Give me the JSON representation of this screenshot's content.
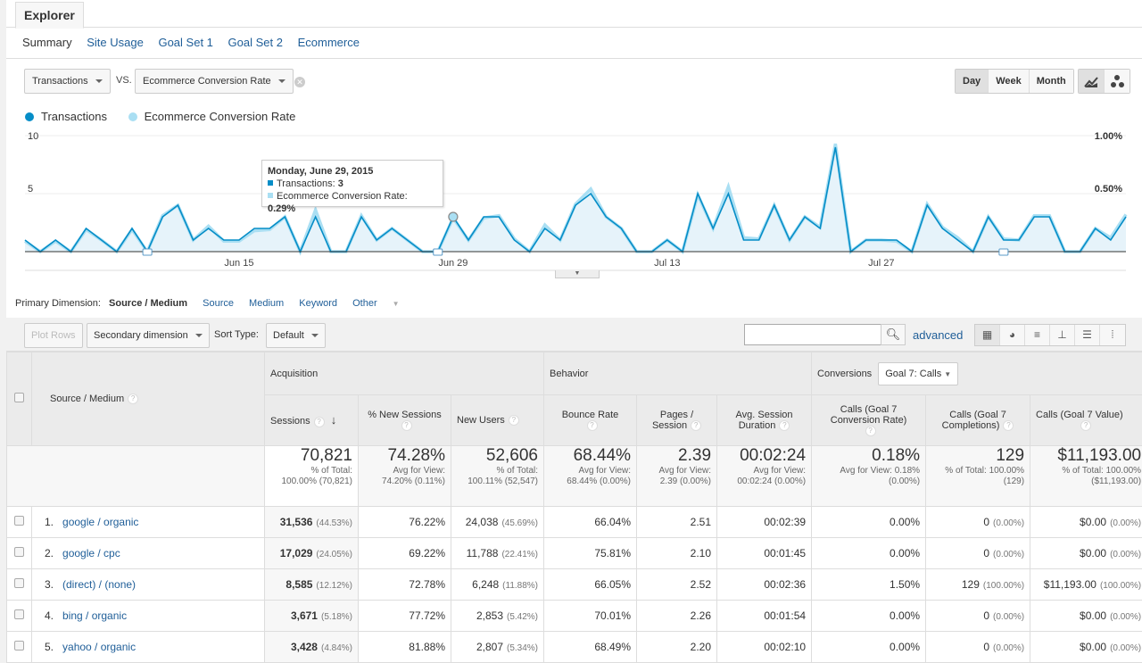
{
  "tab": "Explorer",
  "subtabs": [
    "Summary",
    "Site Usage",
    "Goal Set 1",
    "Goal Set 2",
    "Ecommerce"
  ],
  "metric1": "Transactions",
  "vs_label": "VS.",
  "metric2": "Ecommerce Conversion Rate",
  "period_buttons": [
    "Day",
    "Week",
    "Month"
  ],
  "period_selected": "Day",
  "legend": [
    {
      "label": "Transactions",
      "color": "#058dc7"
    },
    {
      "label": "Ecommerce Conversion Rate",
      "color": "#aadff3"
    }
  ],
  "tooltip": {
    "date": "Monday, June 29, 2015",
    "line1_label": "Transactions: ",
    "line1_value": "3",
    "line2_label": "Ecommerce Conversion Rate: ",
    "line2_value": "0.29%"
  },
  "chart_data": {
    "type": "area",
    "title": "",
    "x_tick_labels": [
      "Jun 15",
      "Jun 29",
      "Jul 13",
      "Jul 27"
    ],
    "x_tick_indices": [
      14,
      28,
      42,
      56
    ],
    "y_left_ticks": [
      "5",
      "10"
    ],
    "y_left_range": [
      0,
      10
    ],
    "y_right_ticks": [
      "0.50%",
      "1.00%"
    ],
    "y_right_range": [
      0,
      1.0
    ],
    "grid": true,
    "legend_position": "top-left",
    "highlight_index": 28,
    "annotation_indices": [
      8,
      27,
      64
    ],
    "series": [
      {
        "name": "Transactions",
        "axis": "left",
        "values": [
          1,
          0,
          1,
          0,
          2,
          1,
          0,
          2,
          0,
          3,
          4,
          1,
          2,
          1,
          1,
          2,
          2,
          3,
          0,
          3,
          0,
          0,
          3,
          1,
          2,
          1,
          0,
          0,
          3,
          1,
          3,
          3,
          1,
          0,
          2,
          1,
          4,
          5,
          3,
          2,
          0,
          0,
          1,
          0,
          5,
          2,
          5,
          1,
          1,
          4,
          1,
          3,
          2,
          9,
          0,
          1,
          1,
          1,
          0,
          4,
          2,
          1,
          0,
          3,
          1,
          1,
          3,
          3,
          0,
          0,
          2,
          1,
          3
        ]
      },
      {
        "name": "Ecommerce Conversion Rate",
        "axis": "right",
        "values": [
          0.09,
          0,
          0.09,
          0,
          0.19,
          0.1,
          0,
          0.19,
          0,
          0.31,
          0.4,
          0.1,
          0.22,
          0.09,
          0.09,
          0.18,
          0.19,
          0.3,
          0,
          0.36,
          0,
          0,
          0.31,
          0.1,
          0.2,
          0.1,
          0,
          0,
          0.29,
          0.1,
          0.29,
          0.31,
          0.11,
          0,
          0.23,
          0.1,
          0.41,
          0.54,
          0.3,
          0.2,
          0,
          0,
          0.1,
          0,
          0.49,
          0.2,
          0.56,
          0.12,
          0.11,
          0.4,
          0.1,
          0.3,
          0.21,
          0.93,
          0,
          0.1,
          0.1,
          0.09,
          0,
          0.41,
          0.21,
          0.12,
          0,
          0.3,
          0.11,
          0.1,
          0.31,
          0.31,
          0,
          0,
          0.2,
          0.12,
          0.32
        ]
      }
    ]
  },
  "primary_dimension": {
    "label": "Primary Dimension:",
    "current": "Source / Medium",
    "options": [
      "Source",
      "Medium",
      "Keyword",
      "Other"
    ]
  },
  "toolbar": {
    "plot_rows": "Plot Rows",
    "secondary_dimension": "Secondary dimension",
    "sort_type_label": "Sort Type:",
    "sort_type_value": "Default",
    "search_value": "",
    "advanced": "advanced"
  },
  "table": {
    "dim_header": "Source / Medium",
    "groups": {
      "acquisition": "Acquisition",
      "behavior": "Behavior",
      "conversions": "Conversions",
      "goal_select": "Goal 7: Calls"
    },
    "columns": [
      "Sessions",
      "% New Sessions",
      "New Users",
      "Bounce Rate",
      "Pages / Session",
      "Avg. Session Duration",
      "Calls (Goal 7 Conversion Rate)",
      "Calls (Goal 7 Completions)",
      "Calls (Goal 7 Value)"
    ],
    "totals": [
      {
        "big": "70,821",
        "sub1": "% of Total:",
        "sub2": "100.00% (70,821)"
      },
      {
        "big": "74.28%",
        "sub1": "Avg for View:",
        "sub2": "74.20% (0.11%)"
      },
      {
        "big": "52,606",
        "sub1": "% of Total:",
        "sub2": "100.11% (52,547)"
      },
      {
        "big": "68.44%",
        "sub1": "Avg for View:",
        "sub2": "68.44% (0.00%)"
      },
      {
        "big": "2.39",
        "sub1": "Avg for View:",
        "sub2": "2.39 (0.00%)"
      },
      {
        "big": "00:02:24",
        "sub1": "Avg for View:",
        "sub2": "00:02:24 (0.00%)"
      },
      {
        "big": "0.18%",
        "sub1": "Avg for View: 0.18%",
        "sub2": "(0.00%)"
      },
      {
        "big": "129",
        "sub1": "% of Total: 100.00%",
        "sub2": "(129)"
      },
      {
        "big": "$11,193.00",
        "sub1": "% of Total: 100.00%",
        "sub2": "($11,193.00)"
      }
    ],
    "rows": [
      {
        "n": "1.",
        "dim": "google / organic",
        "sessions": "31,536",
        "sessions_pct": "(44.53%)",
        "new_sessions": "76.22%",
        "new_users": "24,038",
        "new_users_pct": "(45.69%)",
        "bounce": "66.04%",
        "pages": "2.51",
        "duration": "00:02:39",
        "conv_rate": "0.00%",
        "completions": "0",
        "completions_pct": "(0.00%)",
        "value": "$0.00",
        "value_pct": "(0.00%)"
      },
      {
        "n": "2.",
        "dim": "google / cpc",
        "sessions": "17,029",
        "sessions_pct": "(24.05%)",
        "new_sessions": "69.22%",
        "new_users": "11,788",
        "new_users_pct": "(22.41%)",
        "bounce": "75.81%",
        "pages": "2.10",
        "duration": "00:01:45",
        "conv_rate": "0.00%",
        "completions": "0",
        "completions_pct": "(0.00%)",
        "value": "$0.00",
        "value_pct": "(0.00%)"
      },
      {
        "n": "3.",
        "dim": "(direct) / (none)",
        "sessions": "8,585",
        "sessions_pct": "(12.12%)",
        "new_sessions": "72.78%",
        "new_users": "6,248",
        "new_users_pct": "(11.88%)",
        "bounce": "66.05%",
        "pages": "2.52",
        "duration": "00:02:36",
        "conv_rate": "1.50%",
        "completions": "129",
        "completions_pct": "(100.00%)",
        "value": "$11,193.00",
        "value_pct": "(100.00%)"
      },
      {
        "n": "4.",
        "dim": "bing / organic",
        "sessions": "3,671",
        "sessions_pct": "(5.18%)",
        "new_sessions": "77.72%",
        "new_users": "2,853",
        "new_users_pct": "(5.42%)",
        "bounce": "70.01%",
        "pages": "2.26",
        "duration": "00:01:54",
        "conv_rate": "0.00%",
        "completions": "0",
        "completions_pct": "(0.00%)",
        "value": "$0.00",
        "value_pct": "(0.00%)"
      },
      {
        "n": "5.",
        "dim": "yahoo / organic",
        "sessions": "3,428",
        "sessions_pct": "(4.84%)",
        "new_sessions": "81.88%",
        "new_users": "2,807",
        "new_users_pct": "(5.34%)",
        "bounce": "68.49%",
        "pages": "2.20",
        "duration": "00:02:10",
        "conv_rate": "0.00%",
        "completions": "0",
        "completions_pct": "(0.00%)",
        "value": "$0.00",
        "value_pct": "(0.00%)"
      }
    ]
  }
}
